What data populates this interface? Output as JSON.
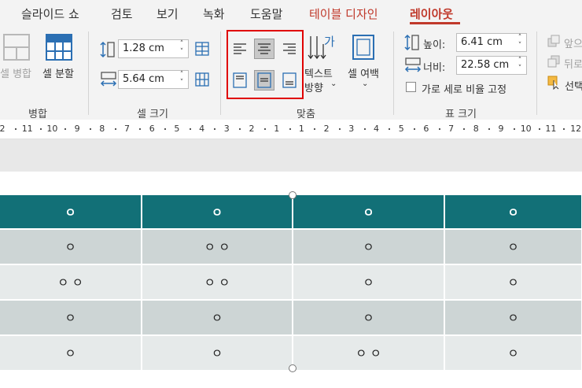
{
  "tabs": [
    "슬라이드 쇼",
    "검토",
    "보기",
    "녹화",
    "도움말",
    "테이블 디자인",
    "레이아웃"
  ],
  "active_tab": "레이아웃",
  "merge_group": {
    "label": "병합",
    "merge_label": "셀 병합",
    "split_label": "셀 분할"
  },
  "cell_size_group": {
    "label": "셀 크기",
    "height_value": "1.28 cm",
    "width_value": "5.64 cm"
  },
  "align_group": {
    "label": "맞춤",
    "text_direction_line1": "텍스트",
    "text_direction_line2": "방향",
    "cell_margin_label": "셀 여백"
  },
  "table_size_group": {
    "label": "표 크기",
    "height_label": "높이:",
    "height_value": "6.41 cm",
    "width_label": "너비:",
    "width_value": "22.58 cm",
    "lock_ratio_label": "가로 세로 비율 고정"
  },
  "arrange_group": {
    "forward_label": "앞으",
    "backward_label": "뒤로",
    "select_label": "선택"
  },
  "ruler": {
    "labels": [
      "2",
      "11",
      "10",
      "9",
      "8",
      "7",
      "6",
      "5",
      "4",
      "3",
      "2",
      "1",
      "1",
      "2",
      "3",
      "4",
      "5",
      "6",
      "7",
      "8",
      "9",
      "10",
      "11",
      "12"
    ]
  },
  "table": {
    "header": [
      "ㅇ",
      "ㅇ",
      "ㅇ",
      "ㅇ"
    ],
    "rows": [
      [
        "ㅇ",
        "ㅇ ㅇ",
        "ㅇ",
        "ㅇ"
      ],
      [
        "ㅇ ㅇ",
        "ㅇ ㅇ",
        "ㅇ",
        "ㅇ"
      ],
      [
        "ㅇ",
        "ㅇ",
        "ㅇ",
        "ㅇ"
      ],
      [
        "ㅇ",
        "ㅇ",
        "ㅇ ㅇ",
        "ㅇ"
      ]
    ]
  },
  "colors": {
    "header_fill": "#127077",
    "row_odd": "#cdd5d5",
    "row_even": "#e6eaea",
    "accent_tab": "#c0392b",
    "highlight_box": "#e00000"
  }
}
